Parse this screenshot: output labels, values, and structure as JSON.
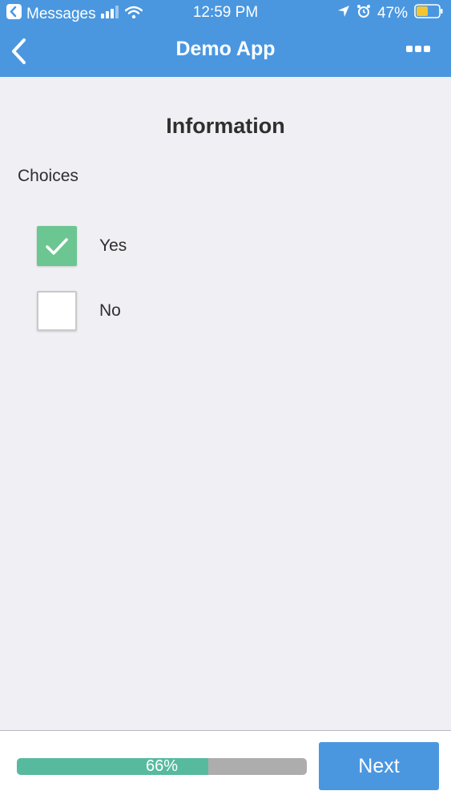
{
  "status_bar": {
    "back_app": "Messages",
    "time": "12:59 PM",
    "battery": "47%"
  },
  "nav": {
    "title": "Demo App"
  },
  "form": {
    "section_title": "Information",
    "field_label": "Choices",
    "options": [
      {
        "label": "Yes",
        "checked": true
      },
      {
        "label": "No",
        "checked": false
      }
    ]
  },
  "footer": {
    "progress_percent": 66,
    "progress_text": "66%",
    "next_label": "Next"
  },
  "colors": {
    "header": "#4a97e0",
    "checked": "#6cc692",
    "progress_fill": "#57ba9f",
    "progress_track": "#adadad"
  }
}
